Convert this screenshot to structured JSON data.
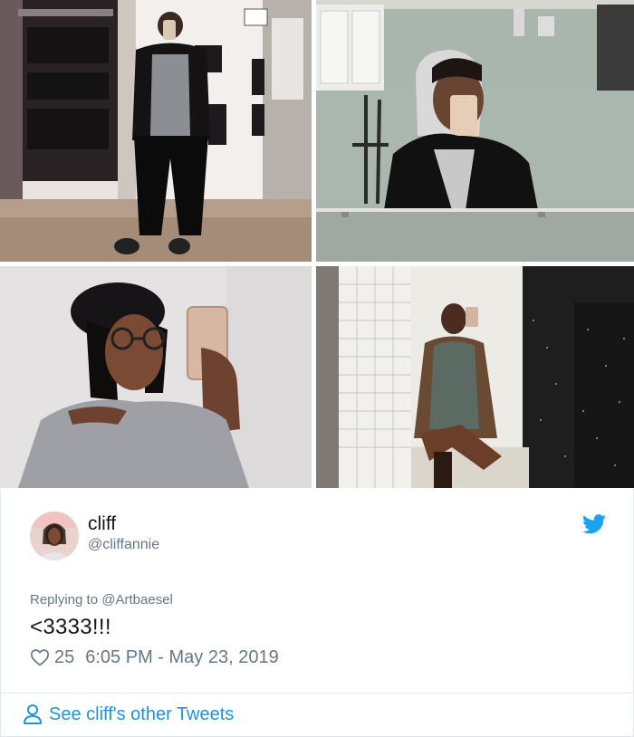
{
  "photos": [
    {
      "description_name": "mirror-selfie-store"
    },
    {
      "description_name": "mirror-selfie-restroom-hoodie"
    },
    {
      "description_name": "selfie-beret-sweater"
    },
    {
      "description_name": "restroom-stall-selfie"
    }
  ],
  "tweet": {
    "name": "cliff",
    "handle": "@cliffannie",
    "reply_prefix": "Replying to ",
    "reply_to": "@Artbaesel",
    "text": "<3333!!!",
    "likes": "25",
    "timestamp": "6:05 PM - May 23, 2019"
  },
  "footer": {
    "label": "See cliff's other Tweets"
  },
  "colors": {
    "twitter_blue": "#1da1f2",
    "link_blue": "#1b95e0",
    "gray_text": "#657786",
    "border": "#e1e8ed"
  },
  "icons": {
    "bird": "twitter-bird-icon",
    "heart": "heart-outline-icon",
    "person": "person-outline-icon"
  }
}
